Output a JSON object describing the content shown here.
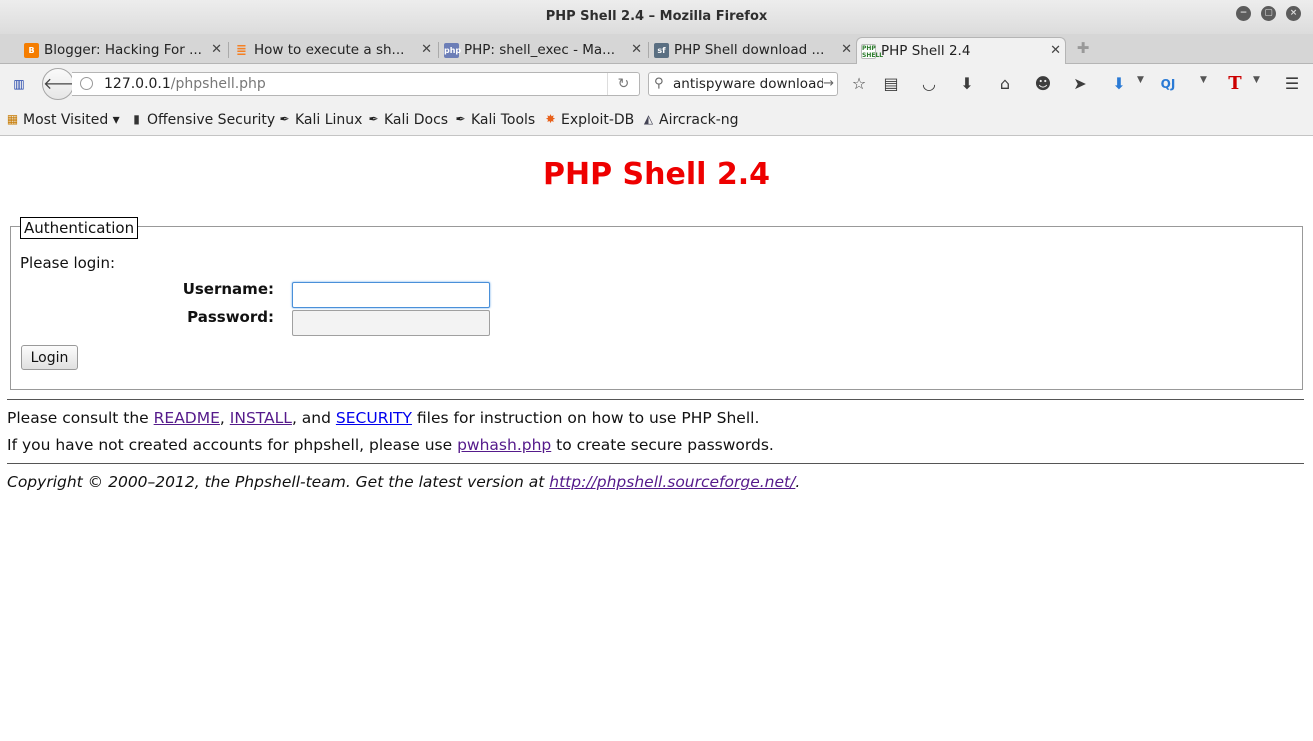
{
  "window": {
    "title": "PHP Shell 2.4 – Mozilla Firefox",
    "buttons": {
      "minimize": "−",
      "maximize": "▢",
      "close": "×"
    }
  },
  "tabs": [
    {
      "label": "Blogger: Hacking For ...",
      "icon": "blogger-icon",
      "color": "#f57d00"
    },
    {
      "label": "How to execute a sh...",
      "icon": "stackoverflow-icon",
      "color": "#f48024"
    },
    {
      "label": "PHP: shell_exec - Ma...",
      "icon": "php-icon",
      "color": "#6c7eb7"
    },
    {
      "label": "PHP Shell download ...",
      "icon": "sourceforge-icon",
      "color": "#5a6f82"
    },
    {
      "label": "PHP Shell 2.4",
      "icon": "phpshell-icon",
      "color": "#2a7a2a",
      "active": true
    }
  ],
  "navbar": {
    "url_host": "127.0.0.1",
    "url_path": "/phpshell.php",
    "search_value": "antispyware download"
  },
  "bookmarks": [
    {
      "label": "Most Visited",
      "dropdown": "▾",
      "icon": "most-visited-icon"
    },
    {
      "label": "Offensive Security",
      "icon": "offsec-icon"
    },
    {
      "label": "Kali Linux",
      "icon": "kali-icon"
    },
    {
      "label": "Kali Docs",
      "icon": "kali-icon"
    },
    {
      "label": "Kali Tools",
      "icon": "kali-icon"
    },
    {
      "label": "Exploit-DB",
      "icon": "exploitdb-icon"
    },
    {
      "label": "Aircrack-ng",
      "icon": "aircrack-icon"
    }
  ],
  "page": {
    "title": "PHP Shell 2.4",
    "auth_legend": "Authentication",
    "please_login": "Please login:",
    "username_label": "Username:",
    "password_label": "Password:",
    "login_button": "Login",
    "consult_prefix": "Please consult the ",
    "readme": "README",
    "comma": ", ",
    "install": "INSTALL",
    "and": ", and ",
    "security": "SECURITY",
    "consult_suffix": " files for instruction on how to use PHP Shell.",
    "accounts_prefix": "If you have not created accounts for phpshell, please use ",
    "pwhash": "pwhash.php",
    "accounts_suffix": " to create secure passwords.",
    "copyright_prefix": "Copyright © 2000–2012, the Phpshell-team. Get the latest version at ",
    "sf_link": "http://phpshell.sourceforge.net/",
    "copyright_suffix": "."
  },
  "colors": {
    "title_red": "#ee0000",
    "visited_link": "#551a8b",
    "link": "#0000ee"
  }
}
